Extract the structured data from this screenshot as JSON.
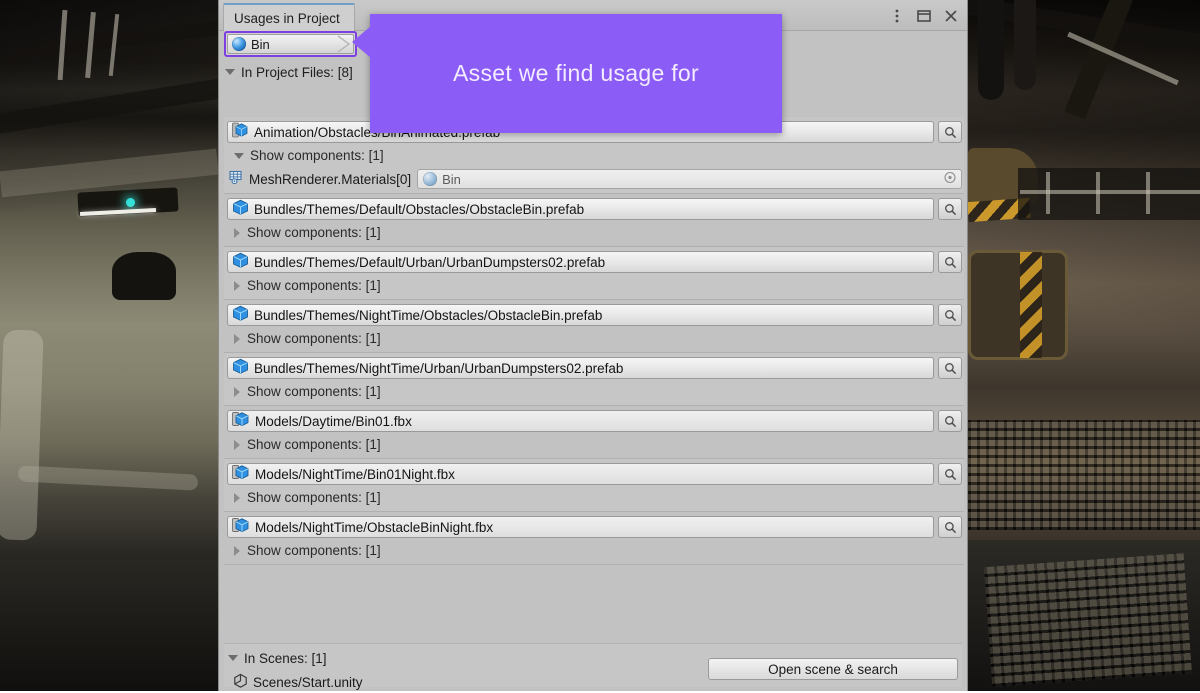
{
  "window": {
    "tab_label": "Usages in Project",
    "controls": [
      {
        "name": "more-options",
        "glyph": "kebab-menu-icon"
      },
      {
        "name": "maximize",
        "glyph": "maximize-icon"
      },
      {
        "name": "close",
        "glyph": "close-icon"
      }
    ]
  },
  "asset_field": {
    "value": "Bin",
    "icon": "material-sphere-icon",
    "highlight_color": "#7e3fe0"
  },
  "callout": {
    "text": "Asset we find usage for",
    "color": "#8b5cf6",
    "text_color": "#f4ecff"
  },
  "project_files": {
    "header": "In Project Files: [8]",
    "expanded": true,
    "entries": [
      {
        "path": "Animation/Obstacles/BinAnimated.prefab",
        "icon": "prefab-cube-icon",
        "components_label": "Show components: [1]",
        "components_expanded": true,
        "components": [
          {
            "label": "MeshRenderer.Materials[0]",
            "icon": "mesh-renderer-icon",
            "value": "Bin",
            "value_icon": "material-sphere-icon"
          }
        ]
      },
      {
        "path": "Bundles/Themes/Default/Obstacles/ObstacleBin.prefab",
        "icon": "prefab-cube-icon",
        "components_label": "Show components: [1]",
        "components_expanded": false,
        "components": []
      },
      {
        "path": "Bundles/Themes/Default/Urban/UrbanDumpsters02.prefab",
        "icon": "prefab-cube-icon",
        "components_label": "Show components: [1]",
        "components_expanded": false,
        "components": []
      },
      {
        "path": "Bundles/Themes/NightTime/Obstacles/ObstacleBin.prefab",
        "icon": "prefab-cube-icon",
        "components_label": "Show components: [1]",
        "components_expanded": false,
        "components": []
      },
      {
        "path": "Bundles/Themes/NightTime/Urban/UrbanDumpsters02.prefab",
        "icon": "prefab-cube-icon",
        "components_label": "Show components: [1]",
        "components_expanded": false,
        "components": []
      },
      {
        "path": "Models/Daytime/Bin01.fbx",
        "icon": "model-fbx-icon",
        "components_label": "Show components: [1]",
        "components_expanded": false,
        "components": []
      },
      {
        "path": "Models/NightTime/Bin01Night.fbx",
        "icon": "model-fbx-icon",
        "components_label": "Show components: [1]",
        "components_expanded": false,
        "components": []
      },
      {
        "path": "Models/NightTime/ObstacleBinNight.fbx",
        "icon": "model-fbx-icon",
        "components_label": "Show components: [1]",
        "components_expanded": false,
        "components": []
      }
    ]
  },
  "scenes": {
    "header": "In Scenes: [1]",
    "expanded": true,
    "entries": [
      {
        "path": "Scenes/Start.unity",
        "icon": "unity-scene-icon"
      }
    ],
    "open_scene_button": "Open scene & search"
  },
  "search_button_icon": "magnifier-icon"
}
